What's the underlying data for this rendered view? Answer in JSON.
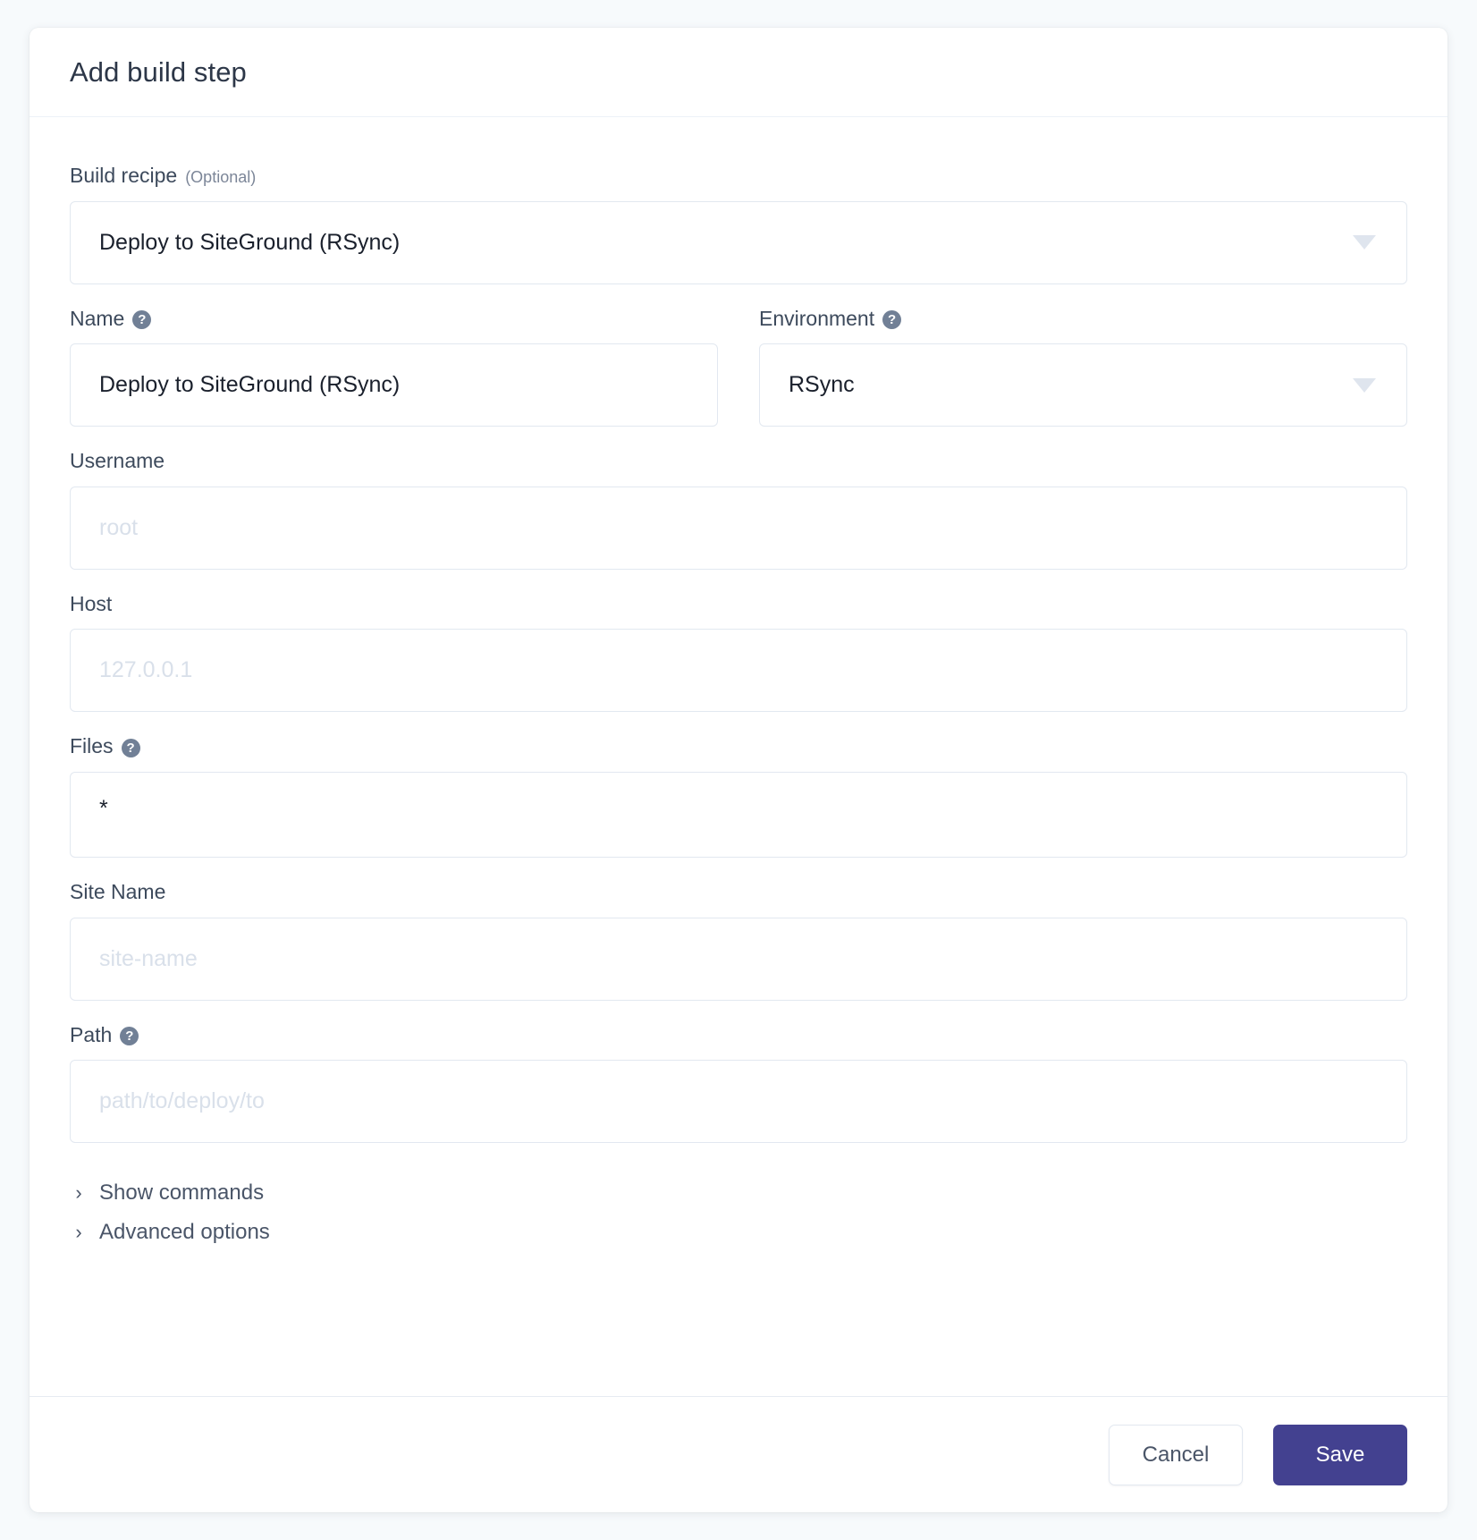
{
  "modal": {
    "title": "Add build step",
    "build_recipe": {
      "label": "Build recipe",
      "optional_tag": "(Optional)",
      "value": "Deploy to SiteGround (RSync)"
    },
    "name": {
      "label": "Name",
      "help": "?",
      "value": "Deploy to SiteGround (RSync)"
    },
    "environment": {
      "label": "Environment",
      "help": "?",
      "value": "RSync"
    },
    "username": {
      "label": "Username",
      "placeholder": "root",
      "value": ""
    },
    "host": {
      "label": "Host",
      "placeholder": "127.0.0.1",
      "value": ""
    },
    "files": {
      "label": "Files",
      "help": "?",
      "value": "*"
    },
    "site_name": {
      "label": "Site Name",
      "placeholder": "site-name",
      "value": ""
    },
    "path": {
      "label": "Path",
      "help": "?",
      "placeholder": "path/to/deploy/to",
      "value": ""
    },
    "disclosures": [
      {
        "chevron": "›",
        "label": "Show commands"
      },
      {
        "chevron": "›",
        "label": "Advanced options"
      }
    ],
    "footer": {
      "cancel_label": "Cancel",
      "save_label": "Save"
    }
  },
  "colors": {
    "page_background": "#f7fafc",
    "card_background": "#ffffff",
    "title_text": "#2d3748",
    "label_text": "#3d4a5c",
    "placeholder_text": "#d9e0ea",
    "input_border": "#e2e8f0",
    "help_icon_background": "#718096",
    "save_button": "#434190",
    "cancel_text": "#4a5568"
  }
}
